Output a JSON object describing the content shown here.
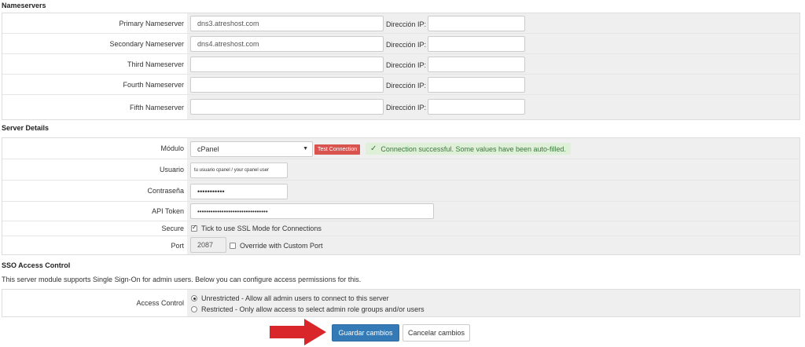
{
  "nameservers": {
    "title": "Nameservers",
    "ip_label": "Dirección IP:",
    "rows": [
      {
        "label": "Primary Nameserver",
        "value": "dns3.atreshost.com",
        "ip": ""
      },
      {
        "label": "Secondary Nameserver",
        "value": "dns4.atreshost.com",
        "ip": ""
      },
      {
        "label": "Third Nameserver",
        "value": "",
        "ip": ""
      },
      {
        "label": "Fourth Nameserver",
        "value": "",
        "ip": ""
      },
      {
        "label": "Fifth Nameserver",
        "value": "",
        "ip": ""
      }
    ]
  },
  "server_details": {
    "title": "Server Details",
    "module_label": "Módulo",
    "module_value": "cPanel",
    "test_button": "Test Connection",
    "success_message": "Connection successful. Some values have been auto-filled.",
    "user_label": "Usuario",
    "user_value": "tu usuario cpanel / your cpanel user",
    "password_label": "Contraseña",
    "password_value": "•••••••••••",
    "api_label": "API Token",
    "api_value": "••••••••••••••••••••••••••••••••",
    "secure_label": "Secure",
    "secure_text": "Tick to use SSL Mode for Connections",
    "secure_checked": true,
    "port_label": "Port",
    "port_value": "2087",
    "override_text": "Override with Custom Port",
    "override_checked": false
  },
  "sso": {
    "title": "SSO Access Control",
    "description": "This server module supports Single Sign-On for admin users. Below you can configure access permissions for this.",
    "access_label": "Access Control",
    "options": [
      {
        "label": "Unrestricted - Allow all admin users to connect to this server",
        "checked": true
      },
      {
        "label": "Restricted - Only allow access to select admin role groups and/or users",
        "checked": false
      }
    ]
  },
  "actions": {
    "save": "Guardar cambios",
    "cancel": "Cancelar cambios"
  },
  "colors": {
    "primary": "#337ab7",
    "danger": "#d9534f",
    "success_bg": "#dff0d8",
    "success_text": "#3c763d",
    "arrow": "#d9262a"
  }
}
